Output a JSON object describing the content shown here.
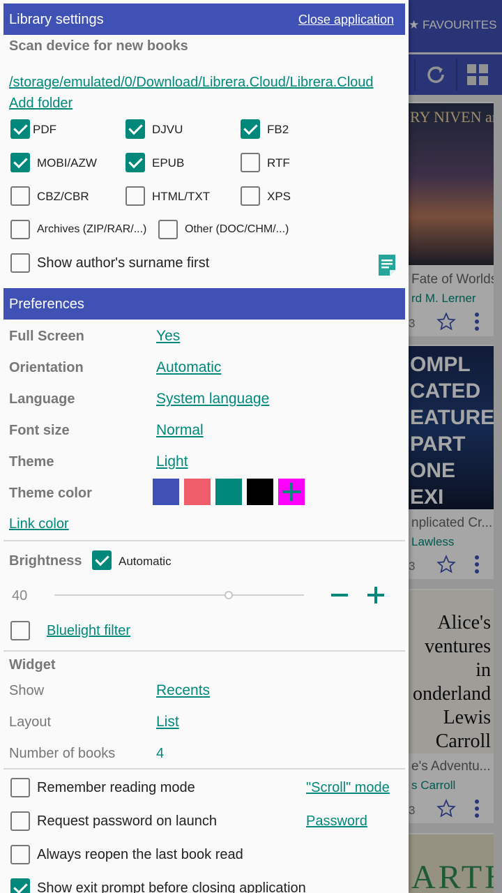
{
  "background": {
    "favourites_label": "FAVOURITES",
    "books": [
      {
        "title": "Fate of Worlds:...",
        "author": "rd M. Lerner",
        "size": "3"
      },
      {
        "title": "nplicated Cr...",
        "author": "Lawless",
        "size": "3"
      },
      {
        "title": "e's Adventu...",
        "author": "s Carroll",
        "size": "3"
      }
    ],
    "covers": [
      {
        "text": "RY NIVEN and ARD M. LERNER FATE of WORLDS"
      },
      {
        "text": "OMPL CATED EATURES PART ONE EXI LAWLESS"
      },
      {
        "text": "Alice's ventures in onderland Lewis Carroll"
      },
      {
        "text": "ARTH"
      }
    ]
  },
  "library_settings": {
    "header": "Library settings",
    "close_label": "Close application",
    "scan_label": "Scan device for new books",
    "path": "/storage/emulated/0/Download/Librera.Cloud/Librera.Cloud",
    "add_folder": "Add folder",
    "formats": [
      {
        "label": "PDF",
        "checked": true
      },
      {
        "label": "DJVU",
        "checked": true
      },
      {
        "label": "FB2",
        "checked": true
      },
      {
        "label": "MOBI/AZW",
        "checked": true
      },
      {
        "label": "EPUB",
        "checked": true
      },
      {
        "label": "RTF",
        "checked": false
      },
      {
        "label": "CBZ/CBR",
        "checked": false
      },
      {
        "label": "HTML/TXT",
        "checked": false
      },
      {
        "label": "XPS",
        "checked": false
      },
      {
        "label": "Archives (ZIP/RAR/...)",
        "checked": false
      },
      {
        "label": "Other (DOC/CHM/...)",
        "checked": false
      }
    ],
    "surname_first": {
      "label": "Show author's surname first",
      "checked": false
    }
  },
  "preferences": {
    "header": "Preferences",
    "rows": [
      {
        "label": "Full Screen",
        "value": "Yes"
      },
      {
        "label": "Orientation",
        "value": "Automatic"
      },
      {
        "label": "Language",
        "value": "System language"
      },
      {
        "label": "Font size",
        "value": "Normal"
      },
      {
        "label": "Theme",
        "value": "Light"
      }
    ],
    "theme_color_label": "Theme color",
    "theme_colors": [
      "#3f51b5",
      "#ef5d6a",
      "#00897b",
      "#000000",
      "#ff00ff"
    ],
    "link_color": "Link color",
    "brightness_label": "Brightness",
    "brightness_auto": {
      "label": "Automatic",
      "checked": true
    },
    "brightness_value": "40",
    "bluelight": {
      "label": "Bluelight filter",
      "checked": false
    }
  },
  "widget": {
    "label": "Widget",
    "show_label": "Show",
    "show_value": "Recents",
    "layout_label": "Layout",
    "layout_value": "List",
    "count_label": "Number of books",
    "count_value": "4"
  },
  "options": [
    {
      "label": "Remember reading mode",
      "checked": false,
      "link": "\"Scroll\" mode"
    },
    {
      "label": "Request password on launch",
      "checked": false,
      "link": "Password"
    },
    {
      "label": "Always reopen the last book read",
      "checked": false,
      "link": ""
    },
    {
      "label": "Show exit prompt before closing application",
      "checked": true,
      "link": ""
    }
  ],
  "accent_color": "#00897b",
  "primary_color": "#3f51b5"
}
